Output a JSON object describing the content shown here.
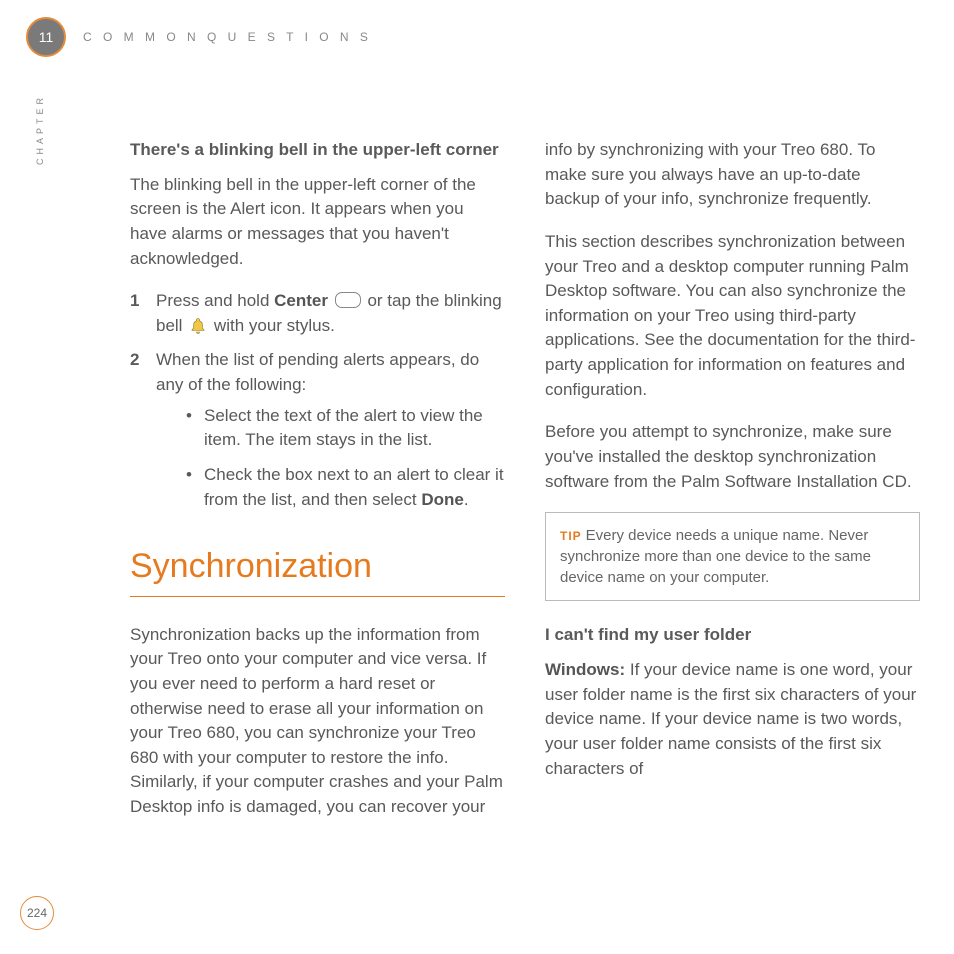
{
  "chapter": {
    "number": "11",
    "label": "CHAPTER",
    "header": "C O M M O N   Q U E S T I O N S"
  },
  "page_number": "224",
  "section1": {
    "heading": "There's a blinking bell in the upper-left corner",
    "intro": "The blinking bell in the upper-left corner of the screen is the Alert icon. It appears when you have alarms or messages that you haven't acknowledged.",
    "step1_num": "1",
    "step1_a": "Press and hold ",
    "step1_center": "Center",
    "step1_b": " or tap the blinking bell ",
    "step1_c": " with your stylus.",
    "step2_num": "2",
    "step2_text": "When the list of pending alerts appears, do any of the following:",
    "bullet1": "Select the text of the alert to view the item. The item stays in the list.",
    "bullet2_a": "Check the box next to an alert to clear it from the list, and then select ",
    "bullet2_done": "Done",
    "bullet2_b": "."
  },
  "sync": {
    "title": "Synchronization",
    "p1": "Synchronization backs up the information from your Treo onto your computer and vice versa. If you ever need to perform a hard reset or otherwise need to erase all your information on your Treo 680, you can synchronize your Treo 680 with your computer to restore the info. Similarly, if your computer crashes and your Palm Desktop info is damaged, you can recover your info by synchronizing with your Treo 680. To make sure you always have an up-to-date backup of your info, synchronize frequently.",
    "p2": "This section describes synchronization between your Treo and a desktop computer running Palm Desktop software. You can also synchronize the information on your Treo using third-party applications. See the documentation for the third-party application for information on features and configuration.",
    "p3": "Before you attempt to synchronize, make sure you've installed the desktop synchronization software from the Palm Software Installation CD."
  },
  "tip": {
    "label": "TIP",
    "text": "Every device needs a unique name. Never synchronize more than one device to the same device name on your computer."
  },
  "section2": {
    "heading": "I can't find my user folder",
    "windows_label": "Windows:",
    "windows_text": " If your device name is one word, your user folder name is the first six characters of your device name. If your device name is two words, your user folder name consists of the first six characters of"
  }
}
